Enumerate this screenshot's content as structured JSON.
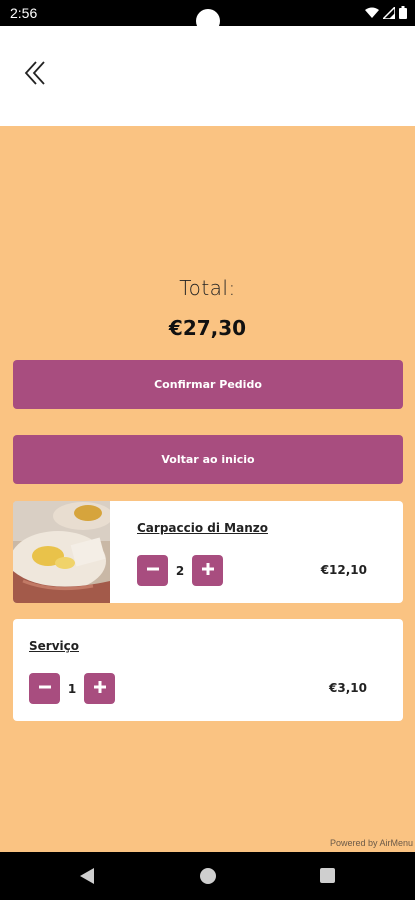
{
  "status_bar": {
    "time": "2:56",
    "icons": [
      "wifi-icon",
      "signal-icon",
      "battery-icon"
    ]
  },
  "header": {
    "back_icon": "double-chevron-left-icon"
  },
  "summary": {
    "total_label": "Total:",
    "total_value": "€27,30"
  },
  "actions": {
    "confirm_label": "Confirmar Pedido",
    "home_label": "Voltar ao inicio"
  },
  "items": [
    {
      "name": "Carpaccio di Manzo",
      "quantity": "2",
      "price": "€12,10",
      "has_image": true
    },
    {
      "name": "Serviço",
      "quantity": "1",
      "price": "€3,10",
      "has_image": false
    }
  ],
  "footer": {
    "powered_by": "Powered by AirMenu"
  },
  "colors": {
    "background": "#fac382",
    "accent": "#a84d7f",
    "card": "#ffffff"
  },
  "nav_bar": {
    "icons": [
      "back-triangle-icon",
      "home-circle-icon",
      "recent-square-icon"
    ]
  }
}
